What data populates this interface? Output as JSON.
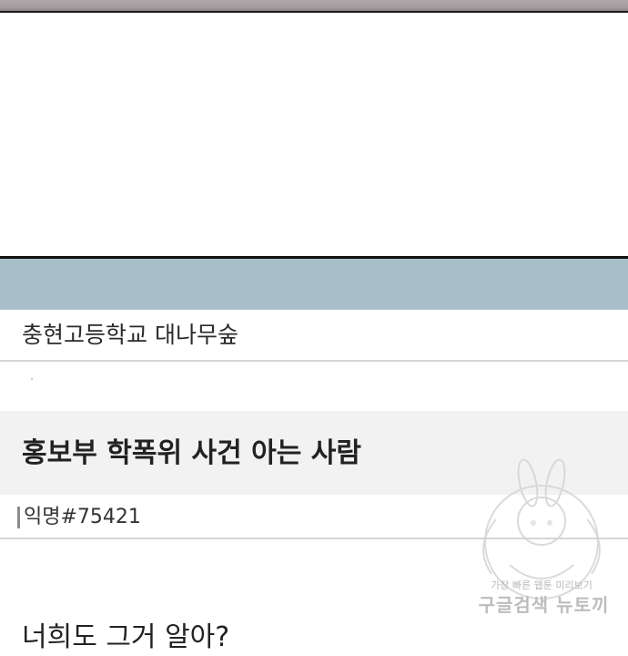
{
  "board": {
    "name": "충현고등학교 대나무숲"
  },
  "post": {
    "title": "홍보부 학폭위 사건 아는 사람",
    "author": "익명#75421",
    "body_preview": "너희도 그거 알아?"
  },
  "watermark": {
    "caption": "가장 빠른 웹툰 미리보기",
    "brand": "구글검색 뉴토끼"
  },
  "colors": {
    "header_band": "#a8bfc9",
    "title_band": "#f2f2f2",
    "divider": "#d6d6d6",
    "panel_border": "#111111"
  }
}
